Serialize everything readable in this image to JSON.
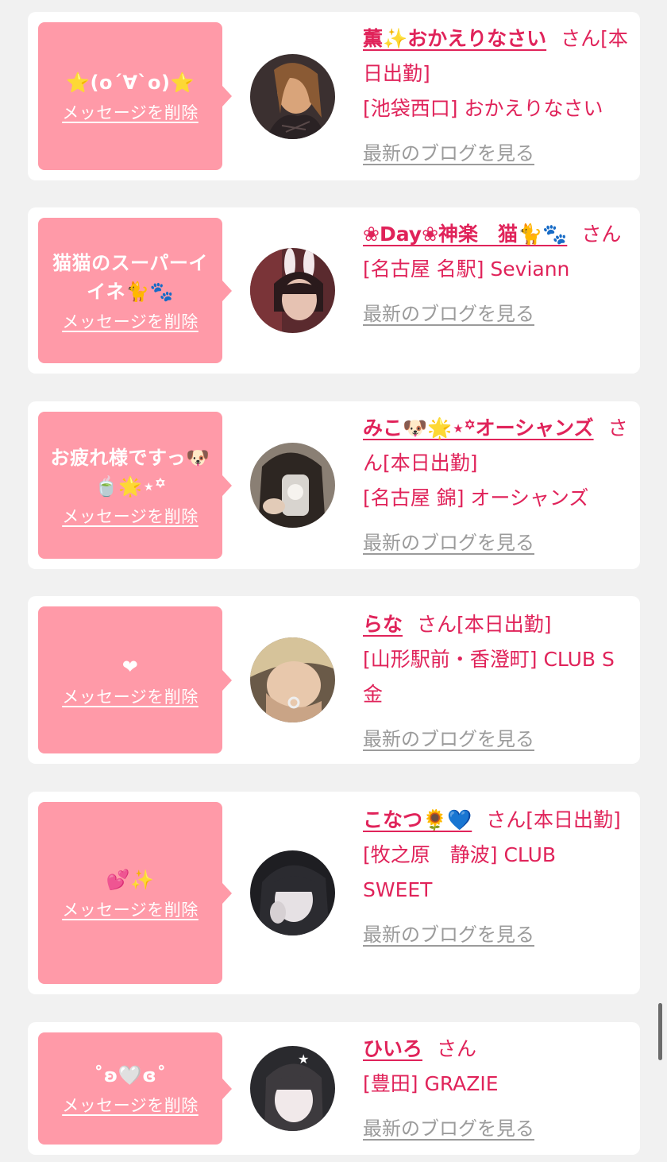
{
  "delete_label": "メッセージを削除",
  "blog_label": "最新のブログを見る",
  "san_label": "さん",
  "cards": [
    {
      "message": "⭐(o´∀`o)⭐",
      "name": "薫✨おかえりなさい",
      "status": "[本日出勤]",
      "shop": "[池袋西口] おかえりなさい"
    },
    {
      "message": "猫猫のスーパーイイネ🐈🐾",
      "name": "❀Day❀神楽　猫🐈🐾",
      "status": "",
      "shop": "[名古屋 名駅] Seviann"
    },
    {
      "message": "お疲れ様ですっ🐶🍵🌟⋆꙳",
      "name": "みこ🐶🌟⋆꙳オーシャンズ",
      "status": "[本日出勤]",
      "shop": "[名古屋 錦] オーシャンズ"
    },
    {
      "message": "❤",
      "name": "らな",
      "status": "[本日出勤]",
      "shop": "[山形駅前・香澄町] CLUB S金"
    },
    {
      "message": "💕✨",
      "name": "こなつ🌻💙",
      "status": "[本日出勤]",
      "shop": "[牧之原　静波] CLUB SWEET"
    },
    {
      "message": "˚ʚ🤍ɞ˚",
      "name": "ひいろ",
      "status": "",
      "shop": "[豊田] GRAZIE"
    }
  ]
}
